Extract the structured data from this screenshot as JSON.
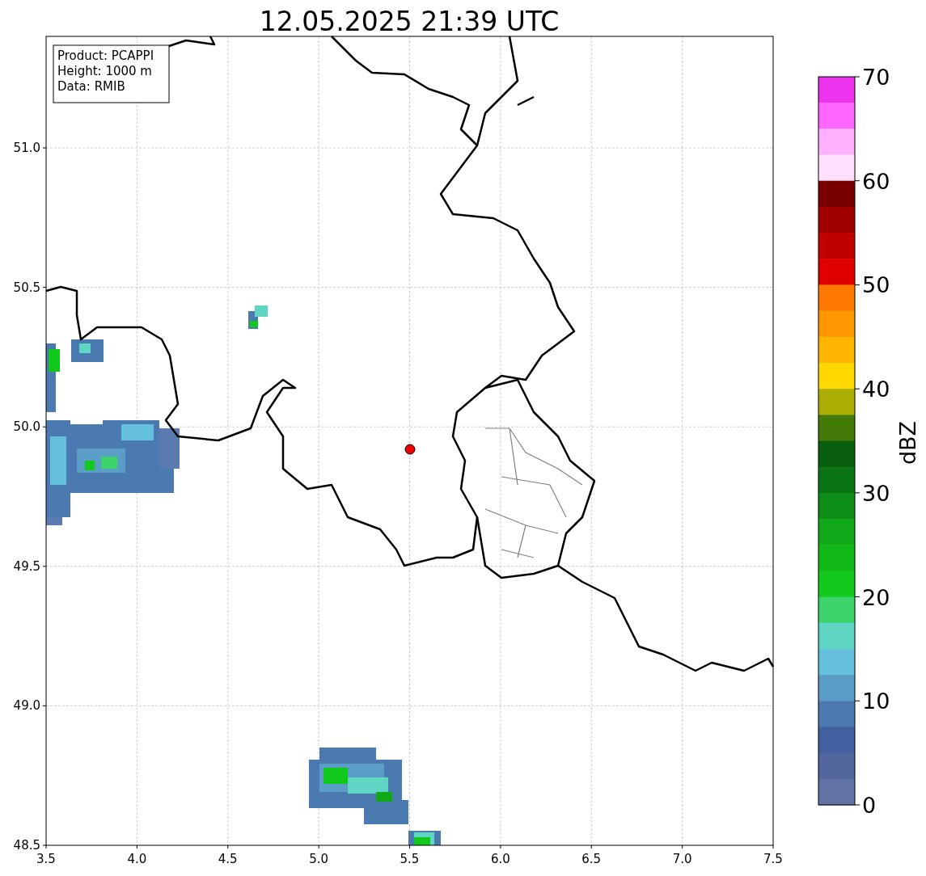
{
  "title": "12.05.2025 21:39 UTC",
  "info_box": [
    "Product: PCAPPI",
    "Height: 1000 m",
    "Data: RMIB"
  ],
  "x_ticks": [
    "3.5",
    "4.0",
    "4.5",
    "5.0",
    "5.5",
    "6.0",
    "6.5",
    "7.0",
    "7.5"
  ],
  "y_ticks": [
    "51.0",
    "50.5",
    "50.0",
    "49.5",
    "49.0",
    "48.5"
  ],
  "colorbar": {
    "label": "dBZ",
    "ticks": [
      "70",
      "60",
      "50",
      "40",
      "30",
      "20",
      "10",
      "0"
    ],
    "bins": [
      {
        "color": "#ee33ee"
      },
      {
        "color": "#ff66ff"
      },
      {
        "color": "#ffb0ff"
      },
      {
        "color": "#ffe0ff"
      },
      {
        "color": "#780000"
      },
      {
        "color": "#a00000"
      },
      {
        "color": "#c00000"
      },
      {
        "color": "#e00000"
      },
      {
        "color": "#ff7800"
      },
      {
        "color": "#ff9800"
      },
      {
        "color": "#ffb400"
      },
      {
        "color": "#ffd800"
      },
      {
        "color": "#acae06"
      },
      {
        "color": "#447a08"
      },
      {
        "color": "#085e0c"
      },
      {
        "color": "#0a7414"
      },
      {
        "color": "#0e8c18"
      },
      {
        "color": "#10a818"
      },
      {
        "color": "#10b818"
      },
      {
        "color": "#12c81c"
      },
      {
        "color": "#3dd46c"
      },
      {
        "color": "#5fd6c4"
      },
      {
        "color": "#64c0dc"
      },
      {
        "color": "#5a9ec8"
      },
      {
        "color": "#4a7ab0"
      },
      {
        "color": "#4260a0"
      },
      {
        "color": "#53669e"
      },
      {
        "color": "#6373a6"
      }
    ]
  }
}
